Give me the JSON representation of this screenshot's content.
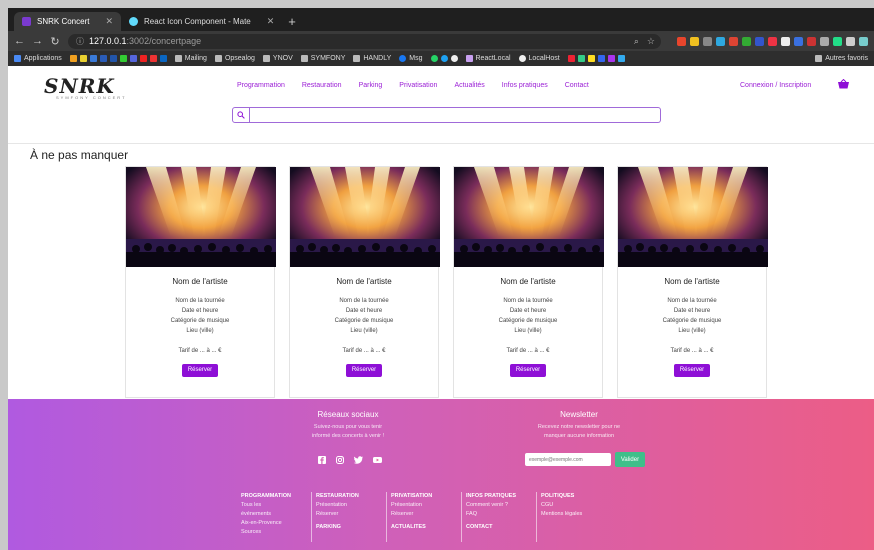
{
  "browser": {
    "tabs": [
      {
        "title": "SNRK Concert",
        "active": true
      },
      {
        "title": "React Icon Component - Mate",
        "active": false
      }
    ],
    "new_tab": "+",
    "url_host": "127.0.0.1",
    "url_port": ":3002",
    "url_path": "/concertpage",
    "bookmarks": [
      "Applications",
      "Mailing",
      "Opsealog",
      "YNOV",
      "SYMFONY",
      "HANDLY",
      "Msg",
      "ReactLocal",
      "LocalHost",
      "Autres favoris"
    ]
  },
  "site": {
    "logo": "SNRK",
    "logo_sub": "SYMFONY CONCERT",
    "nav": [
      "Programmation",
      "Restauration",
      "Parking",
      "Privatisation",
      "Actualités",
      "Infos pratiques",
      "Contact"
    ],
    "login": "Connexion / Inscription",
    "search_placeholder": ""
  },
  "section_title": "À ne pas manquer",
  "cards": [
    {
      "artist": "Nom de l'artiste",
      "tour": "Nom de la tournée",
      "date": "Date et heure",
      "category": "Catégorie de musique",
      "place": "Lieu (ville)",
      "price": "Tarif de ... à ... €",
      "button": "Réserver"
    },
    {
      "artist": "Nom de l'artiste",
      "tour": "Nom de la tournée",
      "date": "Date et heure",
      "category": "Catégorie de musique",
      "place": "Lieu (ville)",
      "price": "Tarif de ... à ... €",
      "button": "Réserver"
    },
    {
      "artist": "Nom de l'artiste",
      "tour": "Nom de la tournée",
      "date": "Date et heure",
      "category": "Catégorie de musique",
      "place": "Lieu (ville)",
      "price": "Tarif de ... à ... €",
      "button": "Réserver"
    },
    {
      "artist": "Nom de l'artiste",
      "tour": "Nom de la tournée",
      "date": "Date et heure",
      "category": "Catégorie de musique",
      "place": "Lieu (ville)",
      "price": "Tarif de ... à ... €",
      "button": "Réserver"
    }
  ],
  "footer": {
    "social_title": "Réseaux sociaux",
    "social_text_1": "Suivez-nous pour vous tenir",
    "social_text_2": "informé des concerts à venir !",
    "newsletter_title": "Newsletter",
    "newsletter_text_1": "Recevez notre newsletter pour ne",
    "newsletter_text_2": "manquer aucune information",
    "newsletter_placeholder": "exemple@exemple.com",
    "newsletter_button": "Valider",
    "columns": [
      {
        "heading": "PROGRAMMATION",
        "links": [
          "Tous les",
          "événements",
          "Aix-en-Provence",
          "Sources"
        ]
      },
      {
        "heading": "RESTAURATION",
        "links": [
          "Présentation",
          "Réserver"
        ],
        "heading2": "PARKING"
      },
      {
        "heading": "PRIVATISATION",
        "links": [
          "Présentation",
          "Réserver"
        ],
        "heading2": "ACTUALITES"
      },
      {
        "heading": "INFOS PRATIQUES",
        "links": [
          "Comment venir ?",
          "FAQ"
        ],
        "heading2": "CONTACT"
      },
      {
        "heading": "POLITIQUES",
        "links": [
          "CGU",
          "Mentions légales"
        ]
      }
    ]
  },
  "colors": {
    "accent": "#9b1fd6",
    "button": "#8e0fd6",
    "valider": "#3fbf8a"
  }
}
